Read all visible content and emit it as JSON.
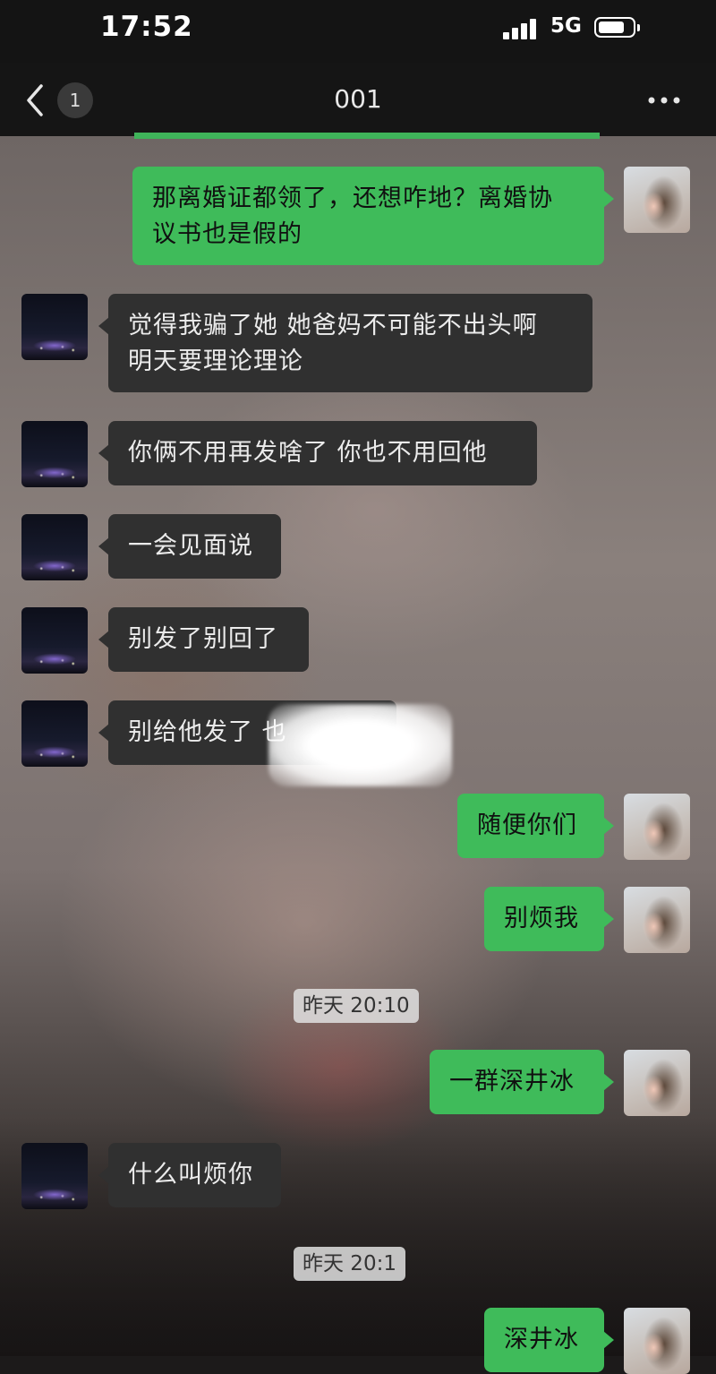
{
  "status_bar": {
    "time": "17:52",
    "network": "5G",
    "icons": [
      "signal-bars-icon",
      "battery-icon"
    ]
  },
  "nav": {
    "back_icon": "chevron-left-icon",
    "unread_count": "1",
    "title": "001",
    "more_icon": "ellipsis-icon"
  },
  "colors": {
    "outgoing_bubble": "#3fbb5a",
    "incoming_bubble": "#303030",
    "timestamp_bg": "#e1e1e1"
  },
  "messages": [
    {
      "side": "out",
      "text": "那离婚证都领了，还想咋地？离婚协\n议书也是假的"
    },
    {
      "side": "in",
      "text": "觉得我骗了她 她爸妈不可能不出头啊\n明天要理论理论"
    },
    {
      "side": "in",
      "text": "你俩不用再发啥了 你也不用回他"
    },
    {
      "side": "in",
      "text": "一会见面说"
    },
    {
      "side": "in",
      "text": "别发了别回了"
    },
    {
      "side": "in",
      "text": "别给他发了 也"
    },
    {
      "side": "out",
      "text": "随便你们"
    },
    {
      "side": "out",
      "text": "别烦我"
    },
    {
      "side": "time",
      "text": "昨天 20:10"
    },
    {
      "side": "out",
      "text": "一群深井冰"
    },
    {
      "side": "in",
      "text": "什么叫烦你"
    },
    {
      "side": "time",
      "text": "昨天 20:1"
    },
    {
      "side": "out",
      "text": "深井冰"
    }
  ]
}
